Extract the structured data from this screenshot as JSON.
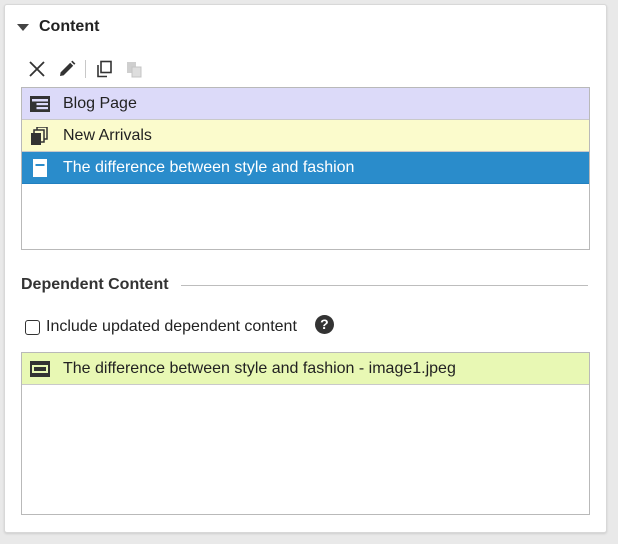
{
  "colors": {
    "blog_page_bg": "#dcdaf9",
    "new_arrivals_bg": "#fbfbcc",
    "selected_bg": "#2a8ccb",
    "dependent_item_bg": "#e8f8b4",
    "icon_dark": "#333333"
  },
  "content_section": {
    "title": "Content",
    "toolbar": [
      {
        "name": "remove",
        "icon": "close-icon"
      },
      {
        "name": "edit",
        "icon": "pencil-icon"
      },
      {
        "name": "duplicate",
        "icon": "copy-icon"
      },
      {
        "name": "paste",
        "icon": "paste-icon",
        "disabled": true
      }
    ],
    "items": [
      {
        "label": "Blog Page",
        "icon": "page-layout-icon",
        "state": "normal"
      },
      {
        "label": "New Arrivals",
        "icon": "page-stack-icon",
        "state": "normal"
      },
      {
        "label": "The difference between style and fashion",
        "icon": "article-icon",
        "state": "selected"
      }
    ]
  },
  "dependent_section": {
    "title": "Dependent Content",
    "include_label": "Include updated dependent content",
    "include_checked": false,
    "help_label": "?",
    "items": [
      {
        "label": "The difference between style and fashion - image1.jpeg",
        "icon": "image-icon"
      }
    ]
  }
}
